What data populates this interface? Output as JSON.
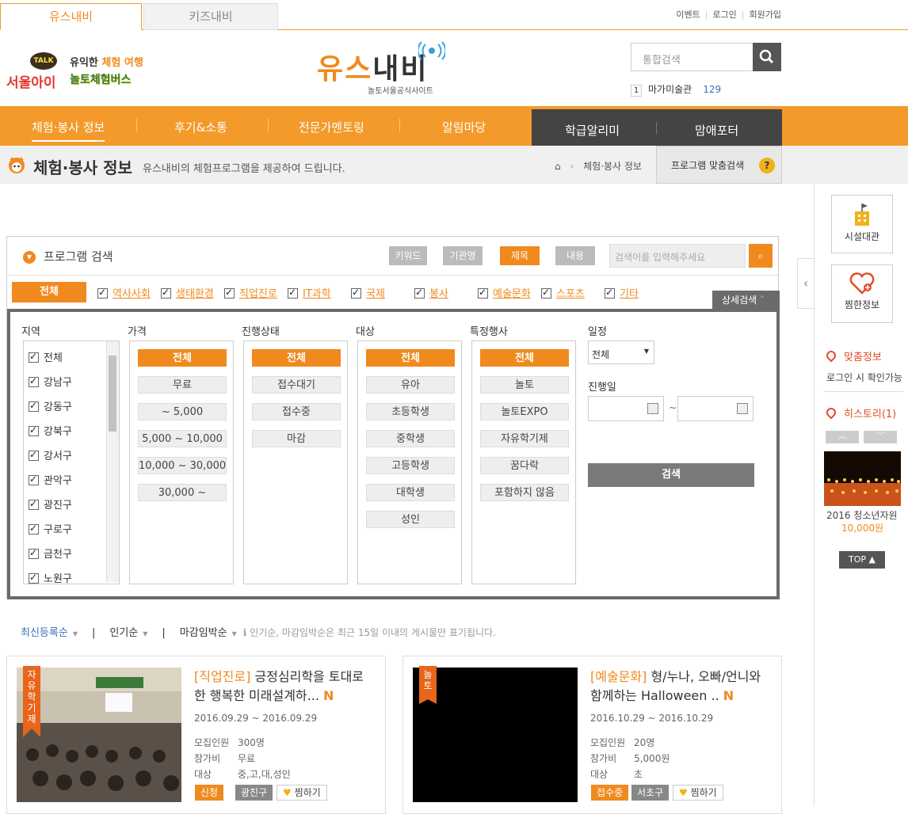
{
  "top_tabs": {
    "youth": "유스내비",
    "kids": "키즈내비"
  },
  "util_links": [
    "이벤트",
    "로그인",
    "회원가입"
  ],
  "brand_left": {
    "talk": "TALK",
    "seoul": "서울아이",
    "slogan1_a": "유익한",
    "slogan1_b": "체험 여행",
    "slogan2": "놀토체험버스"
  },
  "main_logo": {
    "title_orange": "유스",
    "title_dark": "내비",
    "subtitle": "놀토서울공식사이트"
  },
  "search": {
    "placeholder": "통합검색"
  },
  "ranking": {
    "rank": "1",
    "keyword": "마가미술관",
    "count": "129"
  },
  "nav": {
    "items": [
      "체험·봉사 정보",
      "후기&소통",
      "전문가멘토링",
      "알림마당"
    ],
    "dark_items": [
      "학급알리미",
      "맘애포터"
    ]
  },
  "page": {
    "title": "체험·봉사 정보",
    "description": "유스내비의 체험프로그램을 제공하여 드립니다.",
    "breadcrumb": "체험·봉사 정보",
    "custom_search": "프로그램 맞춤검색",
    "custom_icon": "?"
  },
  "program_search": {
    "title": "프로그램 검색",
    "search_types": [
      "키워드",
      "기관명",
      "제목",
      "내용"
    ],
    "active_type": "제목",
    "keyword_placeholder": "검색어를 입력해주세요",
    "categories_all": "전체",
    "categories": [
      "역사사회",
      "생태환경",
      "직업진로",
      "IT과학",
      "국제",
      "봉사",
      "예술문화",
      "스포츠",
      "기타"
    ],
    "detail_toggle": "상세검색",
    "region_label": "지역",
    "regions": [
      "전체",
      "강남구",
      "강동구",
      "강북구",
      "강서구",
      "관악구",
      "광진구",
      "구로구",
      "금천구",
      "노원구"
    ],
    "price_label": "가격",
    "prices": [
      "전체",
      "무료",
      "~ 5,000",
      "5,000 ~ 10,000",
      "10,000 ~ 30,000",
      "30,000 ~"
    ],
    "status_label": "진행상태",
    "statuses": [
      "전체",
      "접수대기",
      "접수중",
      "마감"
    ],
    "target_label": "대상",
    "targets": [
      "전체",
      "유아",
      "초등학생",
      "중학생",
      "고등학생",
      "대학생",
      "성인"
    ],
    "event_label": "특정행사",
    "events": [
      "전체",
      "놀토",
      "놀토EXPO",
      "자유학기제",
      "꿈다락",
      "포함하지 않음"
    ],
    "schedule_label": "일정",
    "schedule_value": "전체",
    "date_label": "진행일",
    "date_sep": "~",
    "submit": "검색"
  },
  "sort": {
    "options": [
      "최신등록순",
      "인기순",
      "마감임박순"
    ],
    "active": "최신등록순",
    "note": "인기순, 마감임박순은 최근 15일 이내의 게시물만 표기됩니다."
  },
  "cards": [
    {
      "ribbon": "자유학기제",
      "category": "[직업진로]",
      "title": " 긍정심리학을 토대로 한 행복한 미래설계하...",
      "new": "N",
      "date": "2016.09.29 ~ 2016.09.29",
      "info": [
        [
          "모집인원",
          "300명"
        ],
        [
          "참가비",
          "무료"
        ],
        [
          "대상",
          "중,고,대,성인"
        ]
      ],
      "status": "신청",
      "region": "광진구",
      "like": "찜하기"
    },
    {
      "ribbon": "놀토",
      "category": "[예술문화]",
      "title": " 형/누나, 오빠/언니와 함께하는 Halloween ..",
      "new": "N",
      "date": "2016.10.29 ~ 2016.10.29",
      "info": [
        [
          "모집인원",
          "20명"
        ],
        [
          "참가비",
          "5,000원"
        ],
        [
          "대상",
          "초"
        ]
      ],
      "status": "접수중",
      "region": "서초구",
      "like": "찜하기"
    }
  ],
  "sidebar": {
    "facility": "시설대관",
    "wishlist": "찜한정보",
    "custom_info": "맞춤정보",
    "custom_info_desc": "로그인 시 확인가능",
    "history": "히스토리(1)",
    "history_item": "2016 청소년자원",
    "history_price": "10,000원",
    "top": "TOP"
  },
  "colors": {
    "accent": "#f39a2a",
    "accent_dark": "#f08a1e",
    "dark_nav": "#444444",
    "link_blue": "#3a6fb5"
  }
}
